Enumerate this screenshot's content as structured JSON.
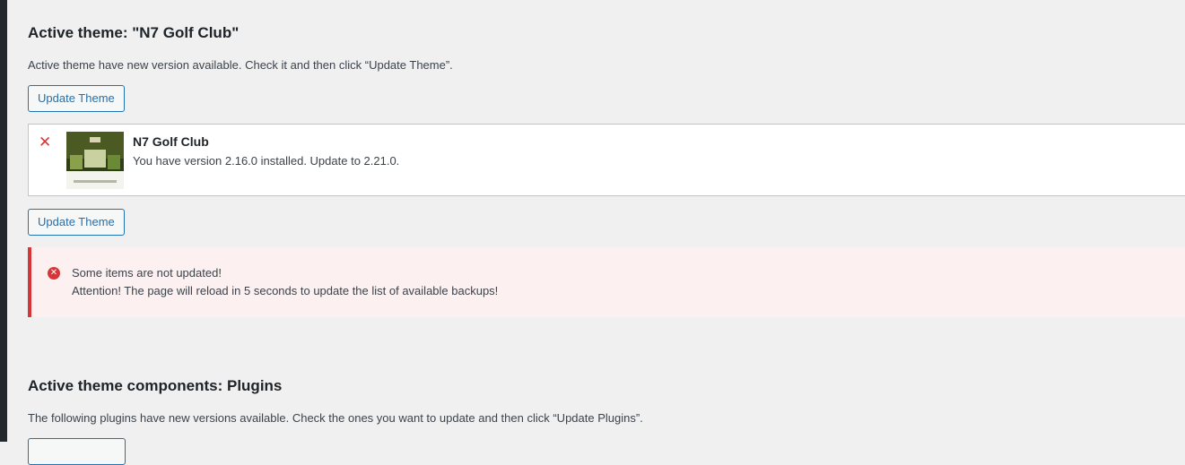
{
  "theme_section": {
    "heading": "Active theme: \"N7 Golf Club\"",
    "description": "Active theme have new version available. Check it and then click “Update Theme”.",
    "update_button_label": "Update Theme"
  },
  "theme_item": {
    "remove_glyph": "✕",
    "name": "N7 Golf Club",
    "version_text": "You have version 2.16.0 installed. Update to 2.21.0.",
    "thumbnail_icon": "theme-screenshot"
  },
  "notice": {
    "icon_glyph": "✕",
    "line1": "Some items are not updated!",
    "line2": "Attention! The page will reload in 5 seconds to update the list of available backups!",
    "color": "#d63638"
  },
  "plugins_section": {
    "heading": "Active theme components: Plugins",
    "description": "The following plugins have new versions available. Check the ones you want to update and then click “Update Plugins”."
  },
  "colors": {
    "accent": "#2271b1",
    "error": "#d63638",
    "background": "#f0f0f1"
  }
}
